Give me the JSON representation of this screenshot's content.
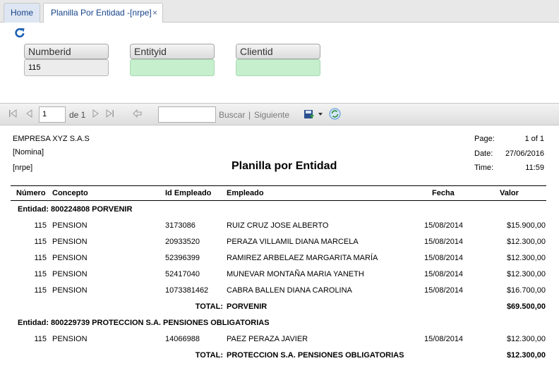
{
  "tabs": [
    {
      "label": "Home"
    },
    {
      "label": "Planilla Por Entidad -[nrpe]",
      "close": "×"
    }
  ],
  "params": {
    "numberid": {
      "label": "Numberid",
      "value": "115"
    },
    "entityid": {
      "label": "Entityid",
      "value": ""
    },
    "clientid": {
      "label": "Clientid",
      "value": ""
    }
  },
  "toolbar": {
    "page": "1",
    "of_label": "de 1",
    "find_value": "",
    "find_label": "Buscar",
    "separator": "|",
    "next_label": "Siguiente"
  },
  "report": {
    "company": "EMPRESA XYZ S.A.S",
    "sub1": "[Nomina]",
    "sub2": "[nrpe]",
    "title": "Planilla por Entidad",
    "page_label": "Page:",
    "page_value": "1 of 1",
    "date_label": "Date:",
    "date_value": "27/06/2016",
    "time_label": "Time:",
    "time_value": "11:59",
    "columns": [
      "Número",
      "Concepto",
      "Id Empleado",
      "Empleado",
      "Fecha",
      "Valor"
    ],
    "groups": [
      {
        "header": "Entidad: 800224808 PORVENIR",
        "rows": [
          {
            "numero": "115",
            "concepto": "PENSION",
            "id": "3173086",
            "empleado": "RUIZ CRUZ JOSE ALBERTO",
            "fecha": "15/08/2014",
            "valor": "$15.900,00"
          },
          {
            "numero": "115",
            "concepto": "PENSION",
            "id": "20933520",
            "empleado": "PERAZA VILLAMIL DIANA MARCELA",
            "fecha": "15/08/2014",
            "valor": "$12.300,00"
          },
          {
            "numero": "115",
            "concepto": "PENSION",
            "id": "52396399",
            "empleado": "RAMIREZ ARBELAEZ MARGARITA MARÍA",
            "fecha": "15/08/2014",
            "valor": "$12.300,00"
          },
          {
            "numero": "115",
            "concepto": "PENSION",
            "id": "52417040",
            "empleado": "MUNEVAR MONTAÑA MARIA YANETH",
            "fecha": "15/08/2014",
            "valor": "$12.300,00"
          },
          {
            "numero": "115",
            "concepto": "PENSION",
            "id": "1073381462",
            "empleado": "CABRA BALLEN DIANA CAROLINA",
            "fecha": "15/08/2014",
            "valor": "$16.700,00"
          }
        ],
        "total_label": "TOTAL:",
        "total_name": "PORVENIR",
        "total_value": "$69.500,00"
      },
      {
        "header": "Entidad: 800229739 PROTECCION S.A. PENSIONES OBLIGATORIAS",
        "rows": [
          {
            "numero": "115",
            "concepto": "PENSION",
            "id": "14066988",
            "empleado": "PAEZ PERAZA JAVIER",
            "fecha": "15/08/2014",
            "valor": "$12.300,00"
          }
        ],
        "total_label": "TOTAL:",
        "total_name": "PROTECCION S.A. PENSIONES OBLIGATORIAS",
        "total_value": "$12.300,00"
      }
    ]
  },
  "colors": {
    "tab_text": "#15428b",
    "accent_icon": "#1a5fb4",
    "param_green": "#c6efce"
  }
}
